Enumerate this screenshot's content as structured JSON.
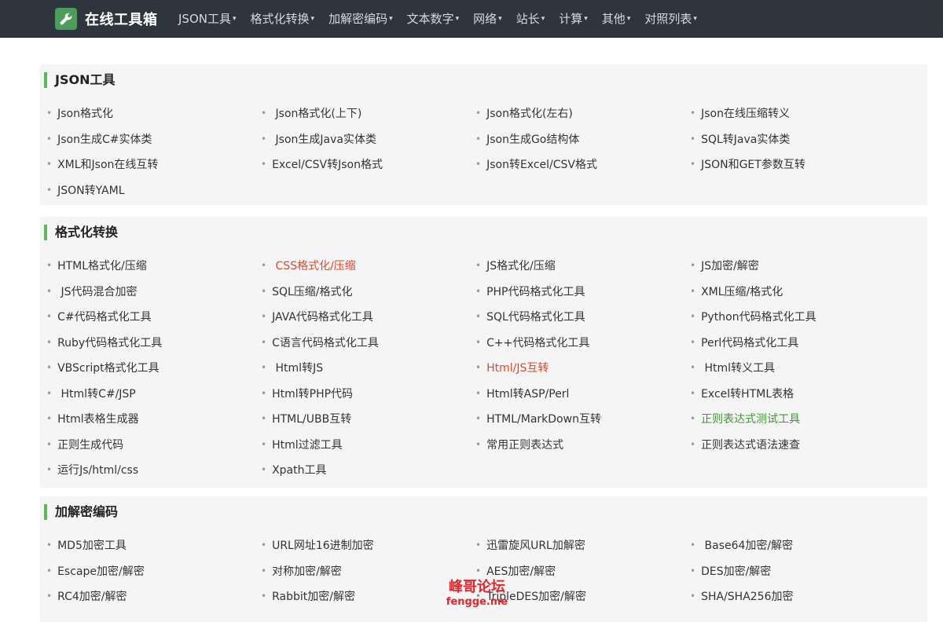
{
  "brand": {
    "title": "在线工具箱",
    "icon": "wrench-icon"
  },
  "nav": [
    {
      "label": "JSON工具"
    },
    {
      "label": "格式化转换"
    },
    {
      "label": "加解密编码"
    },
    {
      "label": "文本数字"
    },
    {
      "label": "网络"
    },
    {
      "label": "站长"
    },
    {
      "label": "计算"
    },
    {
      "label": "其他"
    },
    {
      "label": "对照列表"
    }
  ],
  "nav_caret": "▾",
  "bullet": "•",
  "sections": [
    {
      "title": "JSON工具",
      "links": [
        {
          "label": "Json格式化"
        },
        {
          "label": " Json格式化(上下)"
        },
        {
          "label": "Json格式化(左右)"
        },
        {
          "label": "Json在线压缩转义"
        },
        {
          "label": "Json生成C#实体类"
        },
        {
          "label": " Json生成Java实体类"
        },
        {
          "label": "Json生成Go结构体"
        },
        {
          "label": "SQL转Java实体类"
        },
        {
          "label": "XML和Json在线互转"
        },
        {
          "label": "Excel/CSV转Json格式"
        },
        {
          "label": "Json转Excel/CSV格式"
        },
        {
          "label": "JSON和GET参数互转"
        },
        {
          "label": "JSON转YAML"
        }
      ]
    },
    {
      "title": "格式化转换",
      "links": [
        {
          "label": "HTML格式化/压缩"
        },
        {
          "label": " CSS格式化/压缩",
          "color": "#e0472b"
        },
        {
          "label": "JS格式化/压缩"
        },
        {
          "label": "JS加密/解密"
        },
        {
          "label": " JS代码混合加密"
        },
        {
          "label": "SQL压缩/格式化"
        },
        {
          "label": "PHP代码格式化工具"
        },
        {
          "label": "XML压缩/格式化"
        },
        {
          "label": "C#代码格式化工具"
        },
        {
          "label": "JAVA代码格式化工具"
        },
        {
          "label": "SQL代码格式化工具"
        },
        {
          "label": "Python代码格式化工具"
        },
        {
          "label": "Ruby代码格式化工具"
        },
        {
          "label": "C语言代码格式化工具"
        },
        {
          "label": "C++代码格式化工具"
        },
        {
          "label": "Perl代码格式化工具"
        },
        {
          "label": "VBScript格式化工具"
        },
        {
          "label": " Html转JS"
        },
        {
          "label": "Html/JS互转",
          "color": "#e0472b"
        },
        {
          "label": " Html转义工具"
        },
        {
          "label": " Html转C#/JSP"
        },
        {
          "label": "Html转PHP代码"
        },
        {
          "label": "Html转ASP/Perl"
        },
        {
          "label": "Excel转HTML表格"
        },
        {
          "label": "Html表格生成器"
        },
        {
          "label": "HTML/UBB互转"
        },
        {
          "label": "HTML/MarkDown互转"
        },
        {
          "label": "正则表达式测试工具",
          "color": "#3d9a2f"
        },
        {
          "label": "正则生成代码"
        },
        {
          "label": "Html过滤工具"
        },
        {
          "label": "常用正则表达式"
        },
        {
          "label": "正则表达式语法速查"
        },
        {
          "label": "运行Js/html/css"
        },
        {
          "label": "Xpath工具"
        }
      ]
    },
    {
      "title": "加解密编码",
      "links": [
        {
          "label": "MD5加密工具"
        },
        {
          "label": "URL网址16进制加密"
        },
        {
          "label": "迅雷旋风URL加解密"
        },
        {
          "label": " Base64加密/解密"
        },
        {
          "label": "Escape加密/解密"
        },
        {
          "label": "对称加密/解密"
        },
        {
          "label": "AES加密/解密"
        },
        {
          "label": "DES加密/解密"
        },
        {
          "label": "RC4加密/解密"
        },
        {
          "label": "Rabbit加密/解密"
        },
        {
          "label": "TripleDES加密/解密"
        },
        {
          "label": "SHA/SHA256加密"
        }
      ]
    }
  ],
  "watermark": {
    "line1": "峰哥论坛",
    "line2": "fengge.me"
  }
}
